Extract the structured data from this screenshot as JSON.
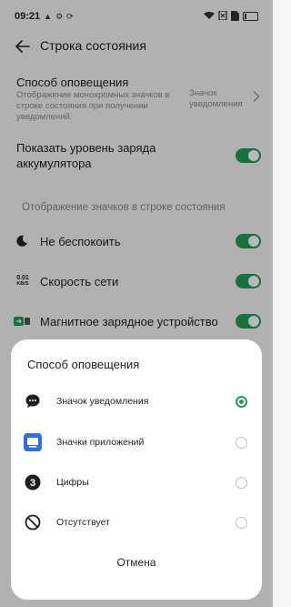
{
  "status_bar": {
    "time": "09:21",
    "battery_level": 0.1
  },
  "header": {
    "title": "Строка состояния"
  },
  "notify_method": {
    "label": "Способ оповещения",
    "description": "Отображение монохромных значков в строке состояния при получении уведомлений.",
    "value": "Значок уведомления"
  },
  "battery_level_setting": {
    "label": "Показать уровень заряда аккумулятора",
    "enabled": true
  },
  "section_icons": {
    "heading": "Отображение значков в строке состояния"
  },
  "icon_items": [
    {
      "label": "Не беспокоить",
      "icon": "moon-icon",
      "enabled": true
    },
    {
      "label": "Скорость сети",
      "icon": "net-speed-icon",
      "icon_value": "0.01",
      "icon_unit": "KB/S",
      "enabled": true
    },
    {
      "label": "Магнитное зарядное устройство",
      "icon": "magnetic-charger-icon",
      "enabled": true
    }
  ],
  "dialog": {
    "title": "Способ оповещения",
    "options": [
      {
        "label": "Значок уведомления",
        "icon": "chat-bubble-icon",
        "selected": true
      },
      {
        "label": "Значки приложений",
        "icon": "app-badge-icon",
        "selected": false
      },
      {
        "label": "Цифры",
        "icon": "number-three-icon",
        "selected": false
      },
      {
        "label": "Отсутствует",
        "icon": "none-icon",
        "selected": false
      }
    ],
    "cancel_label": "Отмена"
  },
  "colors": {
    "accent": "#1f9d55",
    "background": "#f5f5f5",
    "app_icon_blue": "#2f6fe0"
  }
}
